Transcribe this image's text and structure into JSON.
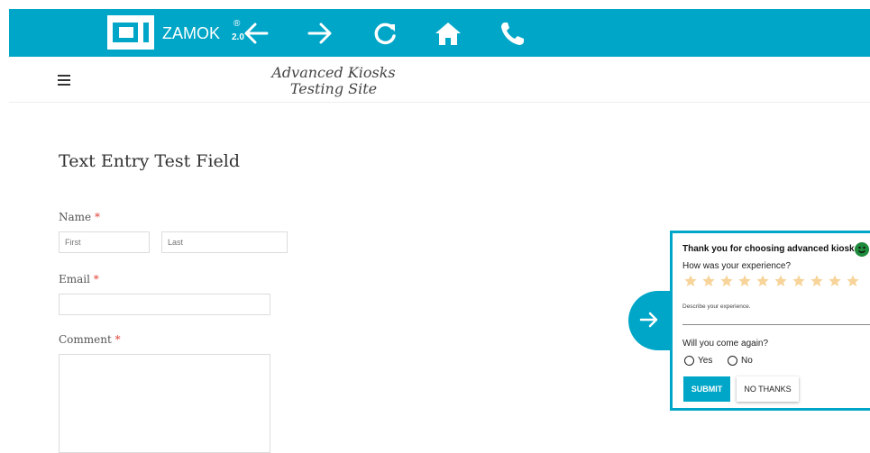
{
  "toolbar": {
    "brand": "ZAMOK",
    "brand_reg": "®",
    "brand_version": "2.0",
    "icons": [
      "back-arrow-icon",
      "forward-arrow-icon",
      "refresh-icon",
      "home-icon",
      "phone-icon"
    ],
    "bar_color": "#00a6c7"
  },
  "header": {
    "site_title_line1": "Advanced Kiosks",
    "site_title_line2": "Testing Site"
  },
  "form": {
    "title": "Text Entry Test Field",
    "name_label": "Name",
    "first_placeholder": "First",
    "last_placeholder": "Last",
    "email_label": "Email",
    "comment_label": "Comment",
    "required_mark": "*",
    "required_color": "#e0443a"
  },
  "survey": {
    "title": "Thank you for choosing advanced kiosks!",
    "question1": "How was your experience?",
    "star_count": 10,
    "star_color": "#f7d49a",
    "describe_placeholder": "Describe your experience.",
    "question2": "Will you come again?",
    "yes_label": "Yes",
    "no_label": "No",
    "submit_label": "SUBMIT",
    "no_thanks_label": "NO THANKS"
  }
}
